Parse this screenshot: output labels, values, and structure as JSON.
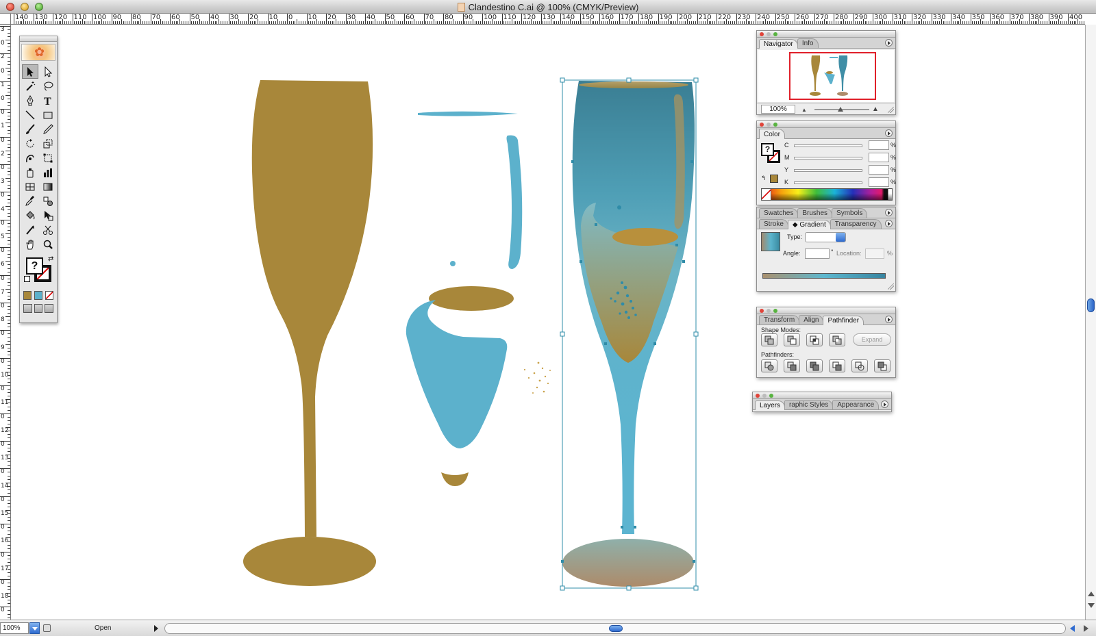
{
  "window": {
    "title": "Clandestino C.ai @ 100% (CMYK/Preview)"
  },
  "ruler": {
    "h_labels": [
      "140",
      "130",
      "120",
      "110",
      "100",
      "90",
      "80",
      "70",
      "60",
      "50",
      "40",
      "30",
      "20",
      "10",
      "0",
      "10",
      "20",
      "30",
      "40",
      "50",
      "60",
      "70",
      "80",
      "90",
      "100",
      "110",
      "120",
      "130",
      "140",
      "150",
      "160",
      "170",
      "180",
      "190",
      "200",
      "210",
      "220",
      "230",
      "240",
      "250",
      "260",
      "270",
      "280",
      "290",
      "300",
      "310",
      "320",
      "330",
      "340",
      "350",
      "360",
      "370",
      "380",
      "390",
      "400",
      "410"
    ],
    "v_labels": [
      "3",
      "0",
      "2",
      "0",
      "1",
      "0",
      "0",
      "1",
      "0",
      "2",
      "0",
      "3",
      "0",
      "4",
      "0",
      "5",
      "0",
      "6",
      "0",
      "7",
      "0",
      "8",
      "0",
      "9",
      "0",
      "10",
      "0",
      "11",
      "0",
      "12",
      "0",
      "13",
      "0",
      "14",
      "0",
      "15",
      "0",
      "16",
      "0",
      "17",
      "0",
      "18",
      "0"
    ]
  },
  "toolbox": {
    "tools": [
      "selection-tool",
      "direct-selection-tool",
      "magic-wand-tool",
      "lasso-tool",
      "pen-tool",
      "type-tool",
      "line-segment-tool",
      "rectangle-tool",
      "paintbrush-tool",
      "pencil-tool",
      "rotate-tool",
      "scale-tool",
      "warp-tool",
      "free-transform-tool",
      "symbol-sprayer-tool",
      "column-graph-tool",
      "mesh-tool",
      "gradient-tool",
      "eyedropper-tool",
      "blend-tool",
      "live-paint-bucket-tool",
      "live-paint-selection-tool",
      "slice-tool",
      "scissors-tool",
      "hand-tool",
      "zoom-tool"
    ],
    "fill_label": "?",
    "modes": [
      "color",
      "gradient",
      "none"
    ],
    "mode_colors": [
      "#a8873a",
      "#5cb1cc",
      "#ffffff"
    ]
  },
  "navigator": {
    "tabs": [
      "Navigator",
      "Info"
    ],
    "active_tab": "Navigator",
    "zoom": "100%"
  },
  "color_panel": {
    "tab": "Color",
    "fill_label": "?",
    "channels": [
      {
        "label": "C",
        "value": ""
      },
      {
        "label": "M",
        "value": ""
      },
      {
        "label": "Y",
        "value": ""
      },
      {
        "label": "K",
        "value": ""
      }
    ],
    "percent_sign": "%",
    "last_color": "#a8873a"
  },
  "swatches_group": {
    "tabs": [
      "Swatches",
      "Brushes",
      "Symbols"
    ]
  },
  "gradient_group": {
    "tabs": [
      "Stroke",
      "Gradient",
      "Transparency"
    ],
    "active_tab": "Gradient",
    "type_label": "Type:",
    "type_value": "",
    "angle_label": "Angle:",
    "angle_value": "",
    "degree_sign": "°",
    "location_label": "Location:",
    "location_value": "",
    "percent_sign": "%"
  },
  "pathfinder_group": {
    "tabs": [
      "Transform",
      "Align",
      "Pathfinder"
    ],
    "active_tab": "Pathfinder",
    "shape_modes_label": "Shape Modes:",
    "shape_modes": [
      "add-to-shape-area",
      "subtract-from-shape-area",
      "intersect-shape-areas",
      "exclude-overlapping-shape-areas"
    ],
    "expand_label": "Expand",
    "pathfinders_label": "Pathfinders:",
    "pathfinders": [
      "divide",
      "trim",
      "merge",
      "crop",
      "outline",
      "minus-back"
    ]
  },
  "layers_group": {
    "tabs": [
      "Layers",
      "raphic Styles",
      "Appearance"
    ],
    "active_tab": "Layers"
  },
  "status_bar": {
    "zoom": "100%",
    "status": "Open"
  },
  "colors": {
    "gold": "#a8873a",
    "blue": "#5cb1cc",
    "teal": "#3a7e93",
    "selection": "#2f8ca8"
  }
}
